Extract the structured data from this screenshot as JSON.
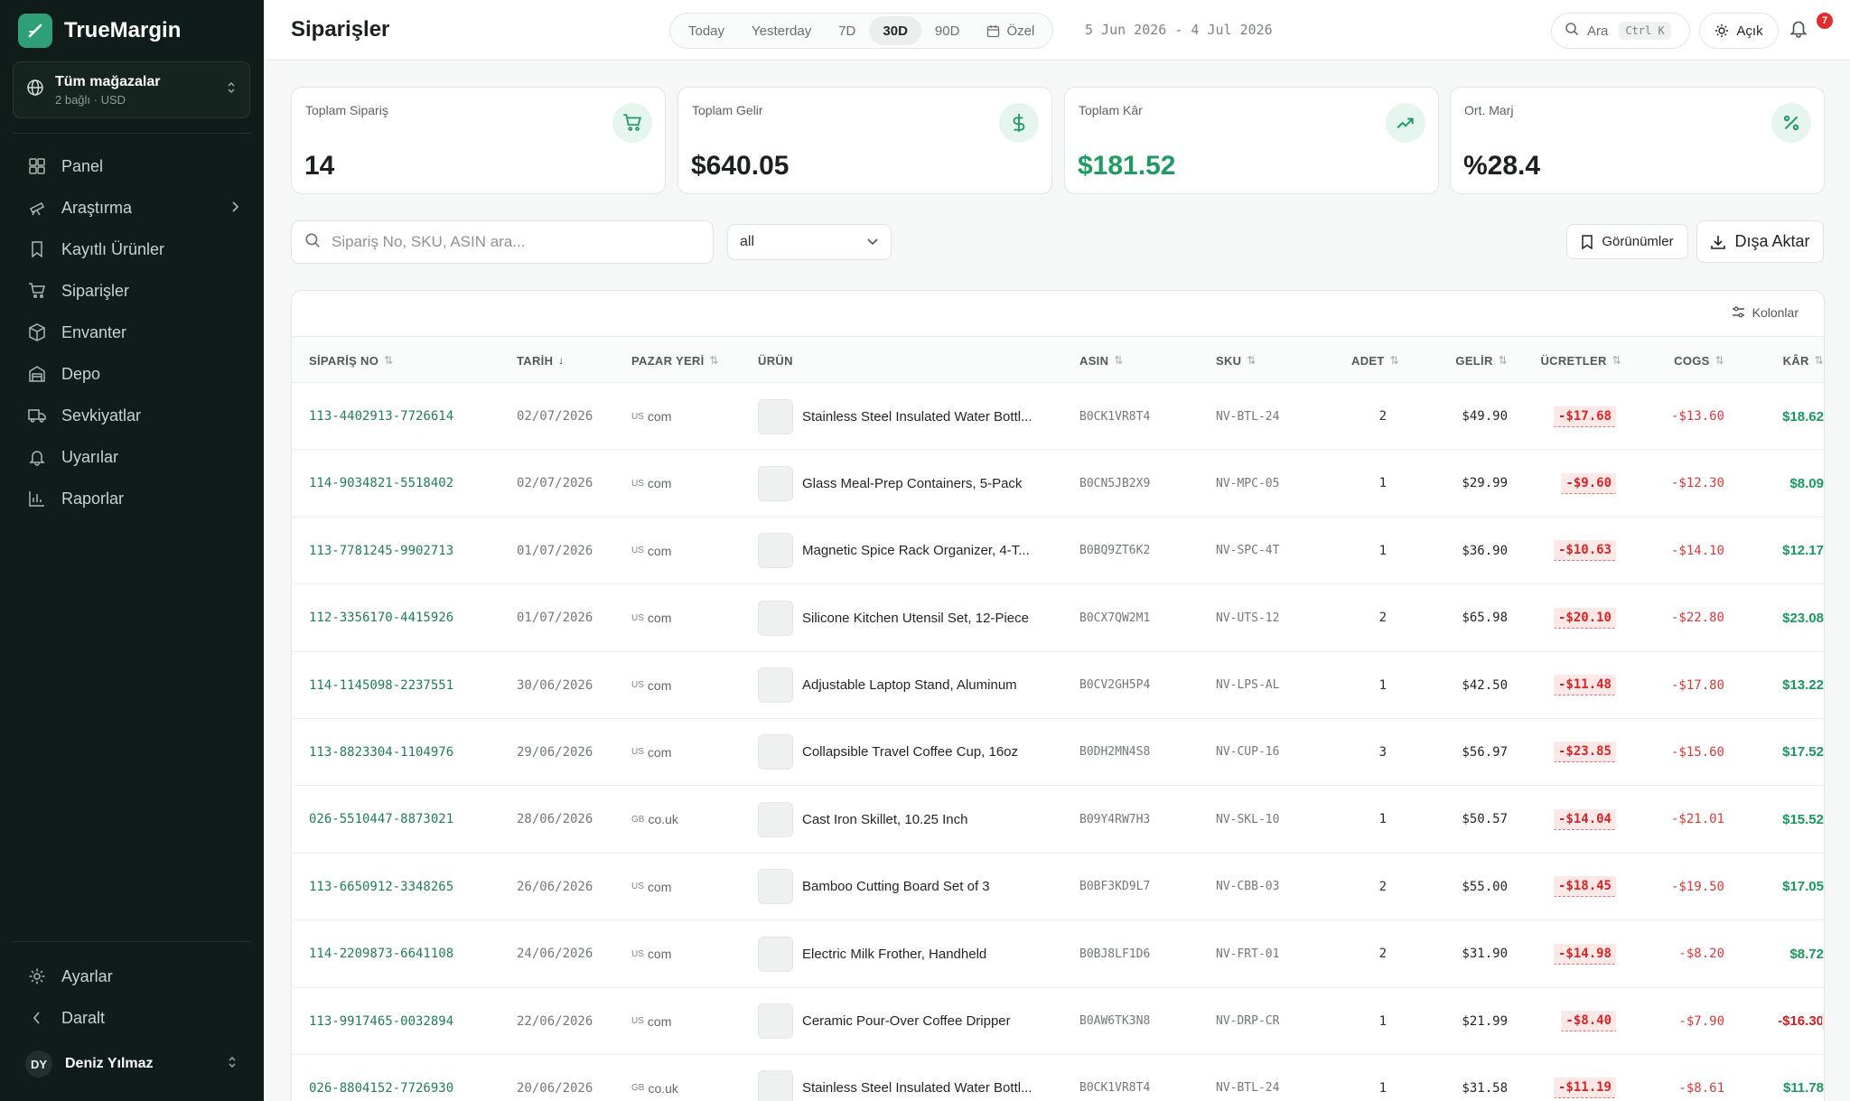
{
  "app": {
    "name": "TrueMargin",
    "store_switcher": {
      "title": "Tüm mağazalar",
      "subtitle": "2 bağlı · USD"
    },
    "nav": [
      {
        "label": "Panel",
        "icon": "grid-icon"
      },
      {
        "label": "Araştırma",
        "icon": "telescope-icon"
      },
      {
        "label": "Kayıtlı Ürünler",
        "icon": "bookmark-icon"
      },
      {
        "label": "Siparişler",
        "icon": "cart-icon"
      },
      {
        "label": "Envanter",
        "icon": "box-icon"
      },
      {
        "label": "Depo",
        "icon": "warehouse-icon"
      },
      {
        "label": "Sevkiyatlar",
        "icon": "truck-icon"
      },
      {
        "label": "Uyarılar",
        "icon": "bell-icon"
      },
      {
        "label": "Raporlar",
        "icon": "bar-chart-icon"
      }
    ],
    "bottom_nav": [
      {
        "label": "Ayarlar",
        "icon": "gear-icon"
      },
      {
        "label": "Daralt",
        "icon": "chevron-left-icon"
      }
    ],
    "user": {
      "initials": "DY",
      "name": "Deniz Yılmaz"
    }
  },
  "header": {
    "title": "Siparişler",
    "range_tabs": [
      "Today",
      "Yesterday",
      "7D",
      "30D",
      "90D"
    ],
    "active_range": "30D",
    "custom_label": "Özel",
    "date_range": "5 Jun 2026 - 4 Jul 2026",
    "search_label": "Ara",
    "search_shortcut": "Ctrl K",
    "theme_label": "Açık",
    "notification_count": "7"
  },
  "kpis": [
    {
      "label": "Toplam Sipariş",
      "value": "14",
      "icon": "cart-icon",
      "tone": "default"
    },
    {
      "label": "Toplam Gelir",
      "value": "$640.05",
      "icon": "dollar-icon",
      "tone": "default"
    },
    {
      "label": "Toplam Kâr",
      "value": "$181.52",
      "icon": "trending-up-icon",
      "tone": "green"
    },
    {
      "label": "Ort. Marj",
      "value": "%28.4",
      "icon": "percent-icon",
      "tone": "default"
    }
  ],
  "filters": {
    "search_placeholder": "Sipariş No, SKU, ASIN ara...",
    "select_value": "all",
    "views_label": "Görünümler",
    "export_label": "Dışa Aktar",
    "columns_label": "Kolonlar"
  },
  "table": {
    "columns": [
      "SİPARİŞ NO",
      "TARİH",
      "PAZAR YERİ",
      "ÜRÜN",
      "ASIN",
      "SKU",
      "ADET",
      "GELİR",
      "ÜCRETLER",
      "COGS",
      "KÂR"
    ],
    "sort_column": "TARİH",
    "rows": [
      {
        "order": "113-4402913-7726614",
        "date": "02/07/2026",
        "flag": "US",
        "market": "com",
        "product": "Stainless Steel Insulated Water Bottl...",
        "asin": "B0CK1VR8T4",
        "sku": "NV-BTL-24",
        "qty": "2",
        "revenue": "$49.90",
        "fees": "-$17.68",
        "cogs": "-$13.60",
        "profit": "$18.62"
      },
      {
        "order": "114-9034821-5518402",
        "date": "02/07/2026",
        "flag": "US",
        "market": "com",
        "product": "Glass Meal-Prep Containers, 5-Pack",
        "asin": "B0CN5JB2X9",
        "sku": "NV-MPC-05",
        "qty": "1",
        "revenue": "$29.99",
        "fees": "-$9.60",
        "cogs": "-$12.30",
        "profit": "$8.09"
      },
      {
        "order": "113-7781245-9902713",
        "date": "01/07/2026",
        "flag": "US",
        "market": "com",
        "product": "Magnetic Spice Rack Organizer, 4-T...",
        "asin": "B0BQ9ZT6K2",
        "sku": "NV-SPC-4T",
        "qty": "1",
        "revenue": "$36.90",
        "fees": "-$10.63",
        "cogs": "-$14.10",
        "profit": "$12.17"
      },
      {
        "order": "112-3356170-4415926",
        "date": "01/07/2026",
        "flag": "US",
        "market": "com",
        "product": "Silicone Kitchen Utensil Set, 12-Piece",
        "asin": "B0CX7QW2M1",
        "sku": "NV-UTS-12",
        "qty": "2",
        "revenue": "$65.98",
        "fees": "-$20.10",
        "cogs": "-$22.80",
        "profit": "$23.08"
      },
      {
        "order": "114-1145098-2237551",
        "date": "30/06/2026",
        "flag": "US",
        "market": "com",
        "product": "Adjustable Laptop Stand, Aluminum",
        "asin": "B0CV2GH5P4",
        "sku": "NV-LPS-AL",
        "qty": "1",
        "revenue": "$42.50",
        "fees": "-$11.48",
        "cogs": "-$17.80",
        "profit": "$13.22"
      },
      {
        "order": "113-8823304-1104976",
        "date": "29/06/2026",
        "flag": "US",
        "market": "com",
        "product": "Collapsible Travel Coffee Cup, 16oz",
        "asin": "B0DH2MN4S8",
        "sku": "NV-CUP-16",
        "qty": "3",
        "revenue": "$56.97",
        "fees": "-$23.85",
        "cogs": "-$15.60",
        "profit": "$17.52"
      },
      {
        "order": "026-5510447-8873021",
        "date": "28/06/2026",
        "flag": "GB",
        "market": "co.uk",
        "product": "Cast Iron Skillet, 10.25 Inch",
        "asin": "B09Y4RW7H3",
        "sku": "NV-SKL-10",
        "qty": "1",
        "revenue": "$50.57",
        "fees": "-$14.04",
        "cogs": "-$21.01",
        "profit": "$15.52"
      },
      {
        "order": "113-6650912-3348265",
        "date": "26/06/2026",
        "flag": "US",
        "market": "com",
        "product": "Bamboo Cutting Board Set of 3",
        "asin": "B0BF3KD9L7",
        "sku": "NV-CBB-03",
        "qty": "2",
        "revenue": "$55.00",
        "fees": "-$18.45",
        "cogs": "-$19.50",
        "profit": "$17.05"
      },
      {
        "order": "114-2209873-6641108",
        "date": "24/06/2026",
        "flag": "US",
        "market": "com",
        "product": "Electric Milk Frother, Handheld",
        "asin": "B0BJ8LF1D6",
        "sku": "NV-FRT-01",
        "qty": "2",
        "revenue": "$31.90",
        "fees": "-$14.98",
        "cogs": "-$8.20",
        "profit": "$8.72"
      },
      {
        "order": "113-9917465-0032894",
        "date": "22/06/2026",
        "flag": "US",
        "market": "com",
        "product": "Ceramic Pour-Over Coffee Dripper",
        "asin": "B0AW6TK3N8",
        "sku": "NV-DRP-CR",
        "qty": "1",
        "revenue": "$21.99",
        "fees": "-$8.40",
        "cogs": "-$7.90",
        "profit": "-$16.30"
      },
      {
        "order": "026-8804152-7726930",
        "date": "20/06/2026",
        "flag": "GB",
        "market": "co.uk",
        "product": "Stainless Steel Insulated Water Bottl...",
        "asin": "B0CK1VR8T4",
        "sku": "NV-BTL-24",
        "qty": "1",
        "revenue": "$31.58",
        "fees": "-$11.19",
        "cogs": "-$8.61",
        "profit": "$11.78"
      }
    ]
  },
  "colors": {
    "sidebar_bg": "#0f1c1a",
    "brand_accent": "#2f9f78",
    "positive": "#179a5b",
    "negative": "#d92323",
    "badge": "#e02d2d"
  }
}
